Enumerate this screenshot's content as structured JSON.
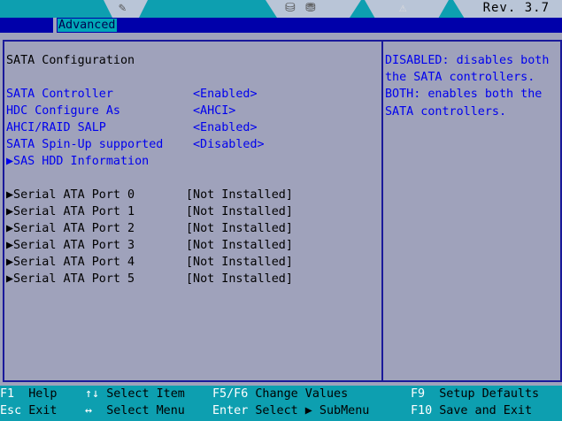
{
  "header": {
    "active_tab": "Advanced",
    "revision": "Rev. 3.7",
    "icons": [
      "pencil-icon",
      "network-drive-icon",
      "warning-triangle-icon"
    ]
  },
  "title": "SATA Configuration",
  "settings": [
    {
      "label": "SATA Controller",
      "value": "<Enabled>"
    },
    {
      "label": "HDC Configure As",
      "value": "<AHCI>"
    },
    {
      "label": "AHCI/RAID SALP",
      "value": "<Enabled>"
    },
    {
      "label": "SATA Spin-Up supported",
      "value": "<Disabled>"
    }
  ],
  "submenu": "▶SAS HDD Information",
  "ports": [
    {
      "label": "▶Serial ATA Port 0",
      "value": "[Not Installed]"
    },
    {
      "label": "▶Serial ATA Port 1",
      "value": "[Not Installed]"
    },
    {
      "label": "▶Serial ATA Port 2",
      "value": "[Not Installed]"
    },
    {
      "label": "▶Serial ATA Port 3",
      "value": "[Not Installed]"
    },
    {
      "label": "▶Serial ATA Port 4",
      "value": "[Not Installed]"
    },
    {
      "label": "▶Serial ATA Port 5",
      "value": "[Not Installed]"
    }
  ],
  "help_text": [
    "DISABLED: disables both",
    "the SATA controllers.",
    "BOTH: enables both the",
    "SATA controllers."
  ],
  "footer": {
    "row1": [
      {
        "key": "F1",
        "text": "Help"
      },
      {
        "key": "↑↓",
        "text": "Select Item"
      },
      {
        "key": "F5/F6",
        "text": "Change Values"
      },
      {
        "key": "F9",
        "text": "Setup Defaults"
      }
    ],
    "row2": [
      {
        "key": "Esc",
        "text": "Exit"
      },
      {
        "key": "↔",
        "text": "Select Menu"
      },
      {
        "key": "Enter",
        "text": "Select ▶ SubMenu"
      },
      {
        "key": "F10",
        "text": "Save and Exit"
      }
    ]
  }
}
